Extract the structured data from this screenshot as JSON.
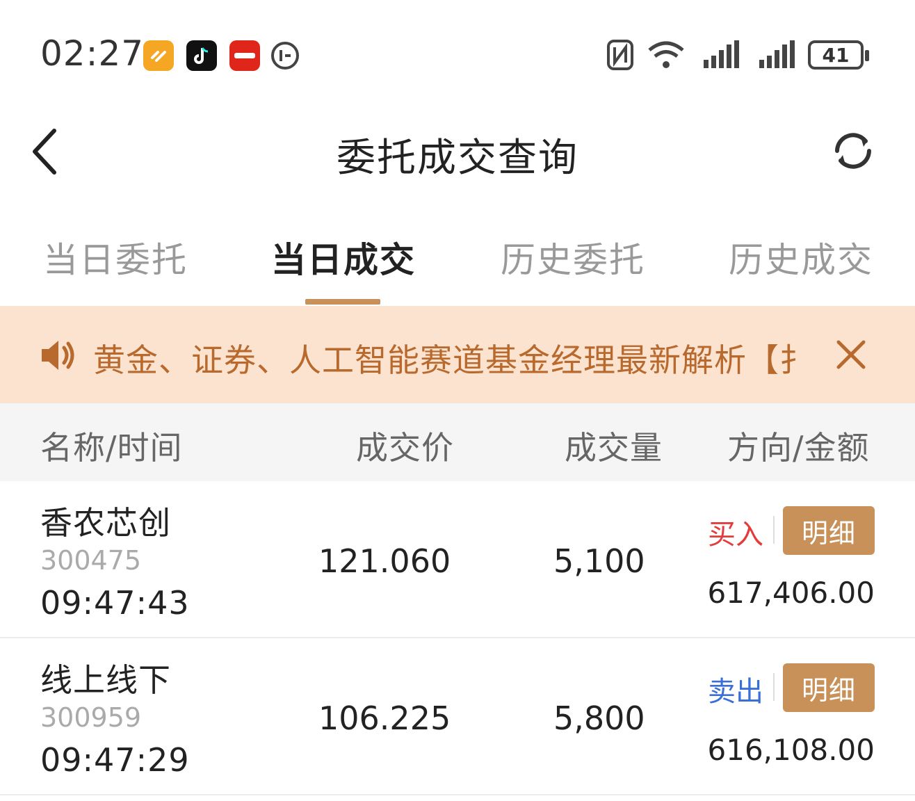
{
  "status_bar": {
    "time": "02:27",
    "battery": "41",
    "icons": [
      "orange-app-icon",
      "tiktok-icon",
      "red-app-icon",
      "circle-app-icon",
      "nfc-icon",
      "wifi-icon",
      "signal-icon",
      "signal-icon",
      "battery-icon"
    ]
  },
  "header": {
    "title": "委托成交查询",
    "back_icon": "chevron-left-icon",
    "refresh_icon": "refresh-icon"
  },
  "tabs": [
    {
      "label": "当日委托",
      "active": false
    },
    {
      "label": "当日成交",
      "active": true
    },
    {
      "label": "历史委托",
      "active": false
    },
    {
      "label": "历史成交",
      "active": false
    }
  ],
  "notice": {
    "text": "黄金、证券、人工智能赛道基金经理最新解析【扌",
    "speaker_icon": "speaker-icon",
    "close_icon": "close-icon"
  },
  "columns": [
    "名称/时间",
    "成交价",
    "成交量",
    "方向/金额"
  ],
  "trades": [
    {
      "name": "香农芯创",
      "code": "300475",
      "time": "09:47:43",
      "price": "121.060",
      "qty": "5,100",
      "direction": "买入",
      "detail": "明细",
      "amount": "617,406.00"
    },
    {
      "name": "线上线下",
      "code": "300959",
      "time": "09:47:29",
      "price": "106.225",
      "qty": "5,800",
      "direction": "卖出",
      "detail": "明细",
      "amount": "616,108.00"
    }
  ],
  "colors": {
    "accent": "#c8915a",
    "buy": "#e23c3c",
    "sell": "#3a6fd8",
    "notice_bg": "#fbe3cf",
    "notice_text": "#b8692d"
  }
}
